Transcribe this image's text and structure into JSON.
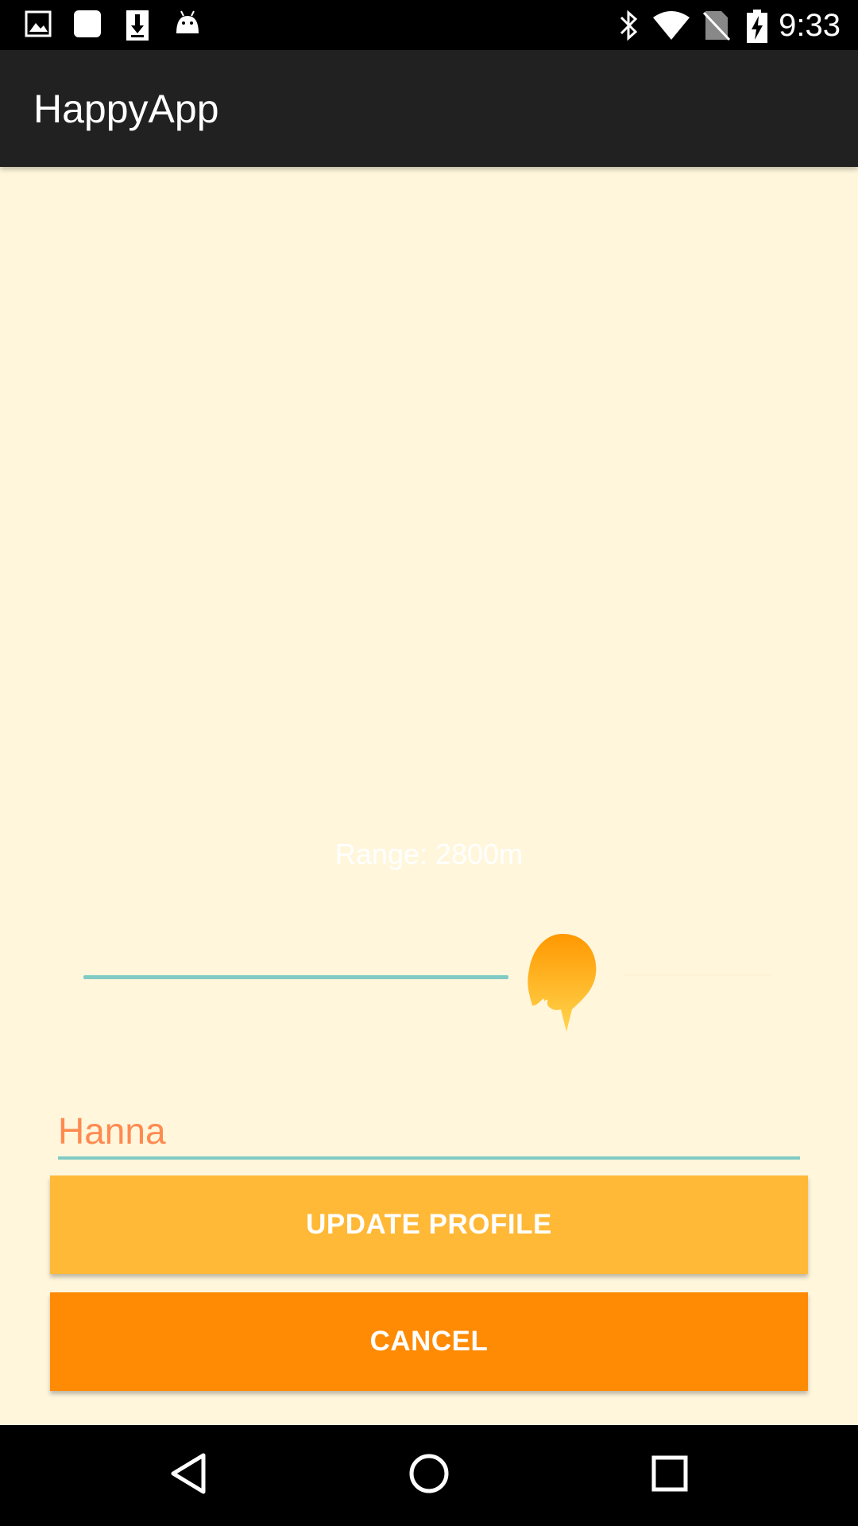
{
  "status_bar": {
    "time": "9:33",
    "left_icons": [
      "image-icon",
      "square-app-icon",
      "download-icon",
      "android-icon"
    ],
    "right_icons": [
      "bluetooth-icon",
      "wifi-icon",
      "no-sim-icon",
      "battery-charging-icon"
    ]
  },
  "app_bar": {
    "title": "HappyApp"
  },
  "range": {
    "label": "Range: 2800m",
    "slider_fraction": 0.67
  },
  "profile": {
    "name_value": "Hanna"
  },
  "buttons": {
    "update_label": "UPDATE PROFILE",
    "cancel_label": "CANCEL"
  },
  "nav_bar": {
    "icons": [
      "back-icon",
      "home-icon",
      "recents-icon"
    ]
  },
  "colors": {
    "background": "#FFF6DC",
    "app_bar": "#212121",
    "accent_teal": "#80CBC4",
    "name_text": "#FF8A50",
    "update_button": "#FFB937",
    "cancel_button": "#FF8A04"
  }
}
